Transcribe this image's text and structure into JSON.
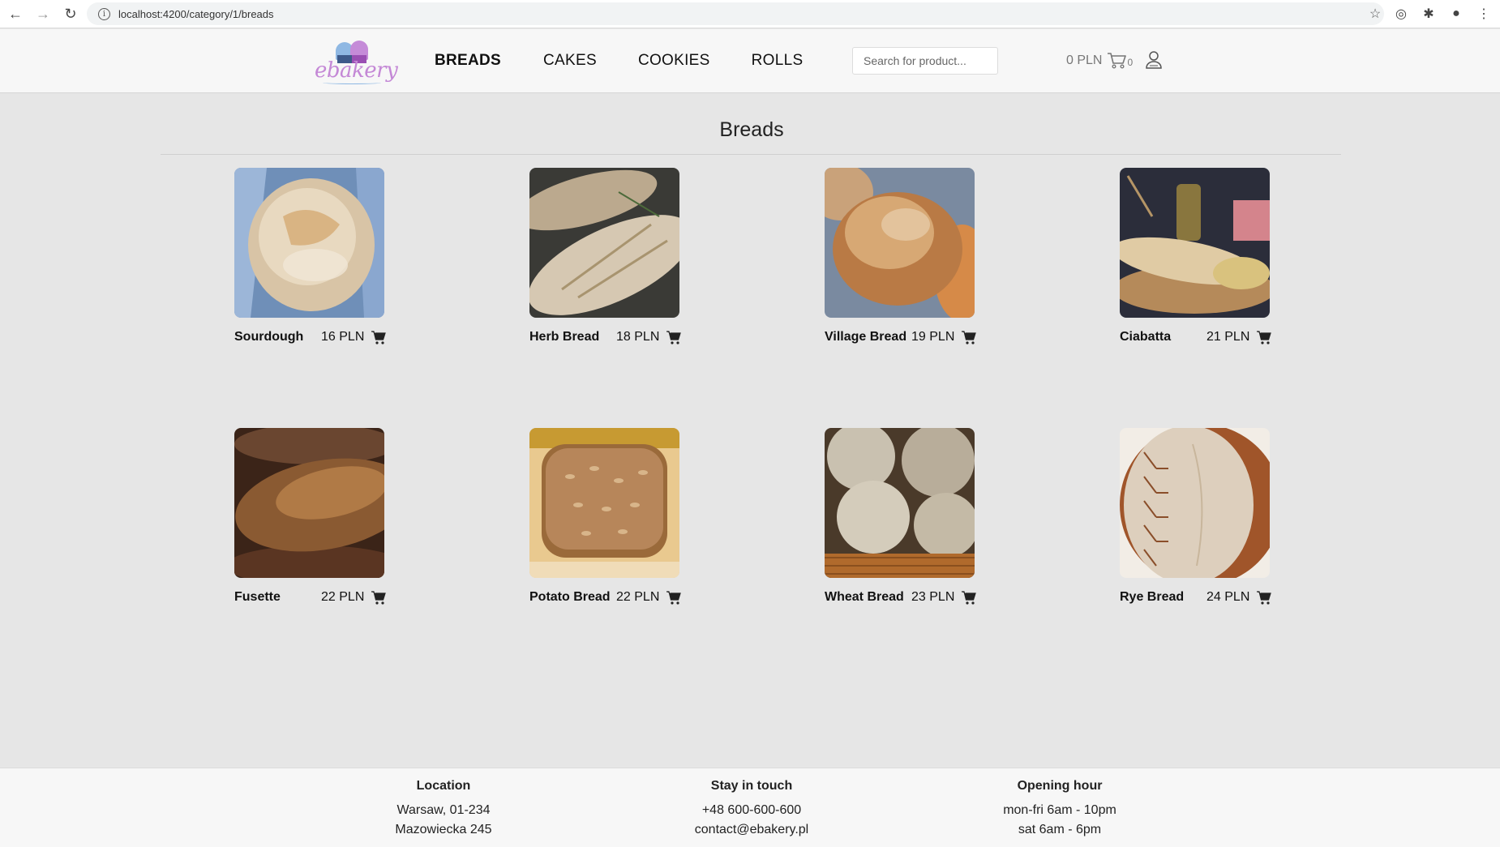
{
  "browser": {
    "url": "localhost:4200/category/1/breads"
  },
  "header": {
    "logo_text": "ebakery",
    "nav": [
      {
        "label": "BREADS",
        "active": true
      },
      {
        "label": "CAKES",
        "active": false
      },
      {
        "label": "COOKIES",
        "active": false
      },
      {
        "label": "ROLLS",
        "active": false
      }
    ],
    "search_placeholder": "Search for product...",
    "cart_total": "0 PLN",
    "cart_count": "0"
  },
  "page": {
    "title": "Breads"
  },
  "products": [
    {
      "name": "Sourdough",
      "price": "16 PLN",
      "image": "sourdough-loaf"
    },
    {
      "name": "Herb Bread",
      "price": "18 PLN",
      "image": "herb-bread"
    },
    {
      "name": "Village Bread",
      "price": "19 PLN",
      "image": "village-bread"
    },
    {
      "name": "Ciabatta",
      "price": "21 PLN",
      "image": "ciabatta"
    },
    {
      "name": "Fusette",
      "price": "22 PLN",
      "image": "fusette"
    },
    {
      "name": "Potato Bread",
      "price": "22 PLN",
      "image": "potato-bread"
    },
    {
      "name": "Wheat Bread",
      "price": "23 PLN",
      "image": "wheat-bread"
    },
    {
      "name": "Rye Bread",
      "price": "24 PLN",
      "image": "rye-bread"
    }
  ],
  "footer": {
    "location": {
      "heading": "Location",
      "line1": "Warsaw, 01-234",
      "line2": "Mazowiecka 245"
    },
    "contact": {
      "heading": "Stay in touch",
      "line1": "+48 600-600-600",
      "line2": "contact@ebakery.pl"
    },
    "hours": {
      "heading": "Opening hour",
      "line1": "mon-fri 6am - 10pm",
      "line2": "sat 6am - 6pm"
    }
  },
  "colors": {
    "page_bg": "#e6e6e6",
    "header_bg": "#f7f7f7",
    "logo_pink": "#c488d6",
    "logo_blue": "#8fb8e3"
  }
}
